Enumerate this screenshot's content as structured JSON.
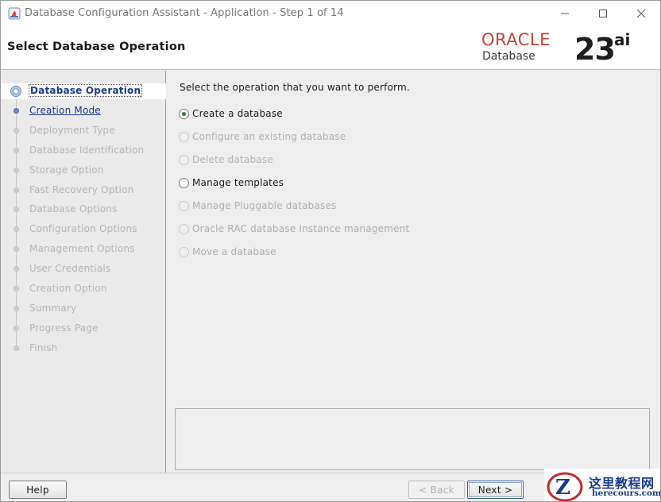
{
  "window": {
    "title": "Database Configuration Assistant - Application - Step 1 of 14"
  },
  "header": {
    "page_title": "Select Database Operation",
    "brand_oracle": "ORACLE",
    "brand_database": "Database",
    "brand_version": "23",
    "brand_suffix": "ai"
  },
  "steps": [
    {
      "label": "Database Operation",
      "state": "current"
    },
    {
      "label": "Creation Mode",
      "state": "link"
    },
    {
      "label": "Deployment Type",
      "state": "disabled"
    },
    {
      "label": "Database Identification",
      "state": "disabled"
    },
    {
      "label": "Storage Option",
      "state": "disabled"
    },
    {
      "label": "Fast Recovery Option",
      "state": "disabled"
    },
    {
      "label": "Database Options",
      "state": "disabled"
    },
    {
      "label": "Configuration Options",
      "state": "disabled"
    },
    {
      "label": "Management Options",
      "state": "disabled"
    },
    {
      "label": "User Credentials",
      "state": "disabled"
    },
    {
      "label": "Creation Option",
      "state": "disabled"
    },
    {
      "label": "Summary",
      "state": "disabled"
    },
    {
      "label": "Progress Page",
      "state": "disabled"
    },
    {
      "label": "Finish",
      "state": "disabled"
    }
  ],
  "main": {
    "instruction": "Select the operation that you want to perform.",
    "options": [
      {
        "label": "Create a database",
        "checked": true,
        "enabled": true
      },
      {
        "label": "Configure an existing database",
        "checked": false,
        "enabled": false
      },
      {
        "label": "Delete database",
        "checked": false,
        "enabled": false
      },
      {
        "label": "Manage templates",
        "checked": false,
        "enabled": true
      },
      {
        "label": "Manage Pluggable databases",
        "checked": false,
        "enabled": false
      },
      {
        "label": "Oracle RAC database Instance management",
        "checked": false,
        "enabled": false
      },
      {
        "label": "Move a database",
        "checked": false,
        "enabled": false
      }
    ]
  },
  "buttons": {
    "help": "Help",
    "back": "< Back",
    "next": "Next >"
  },
  "watermark": {
    "name": "这里教程网",
    "url": "herecours.com"
  },
  "colors": {
    "oracle_red": "#c74634",
    "link_blue": "#1e3a8a",
    "radio_green": "#2e7d32"
  }
}
